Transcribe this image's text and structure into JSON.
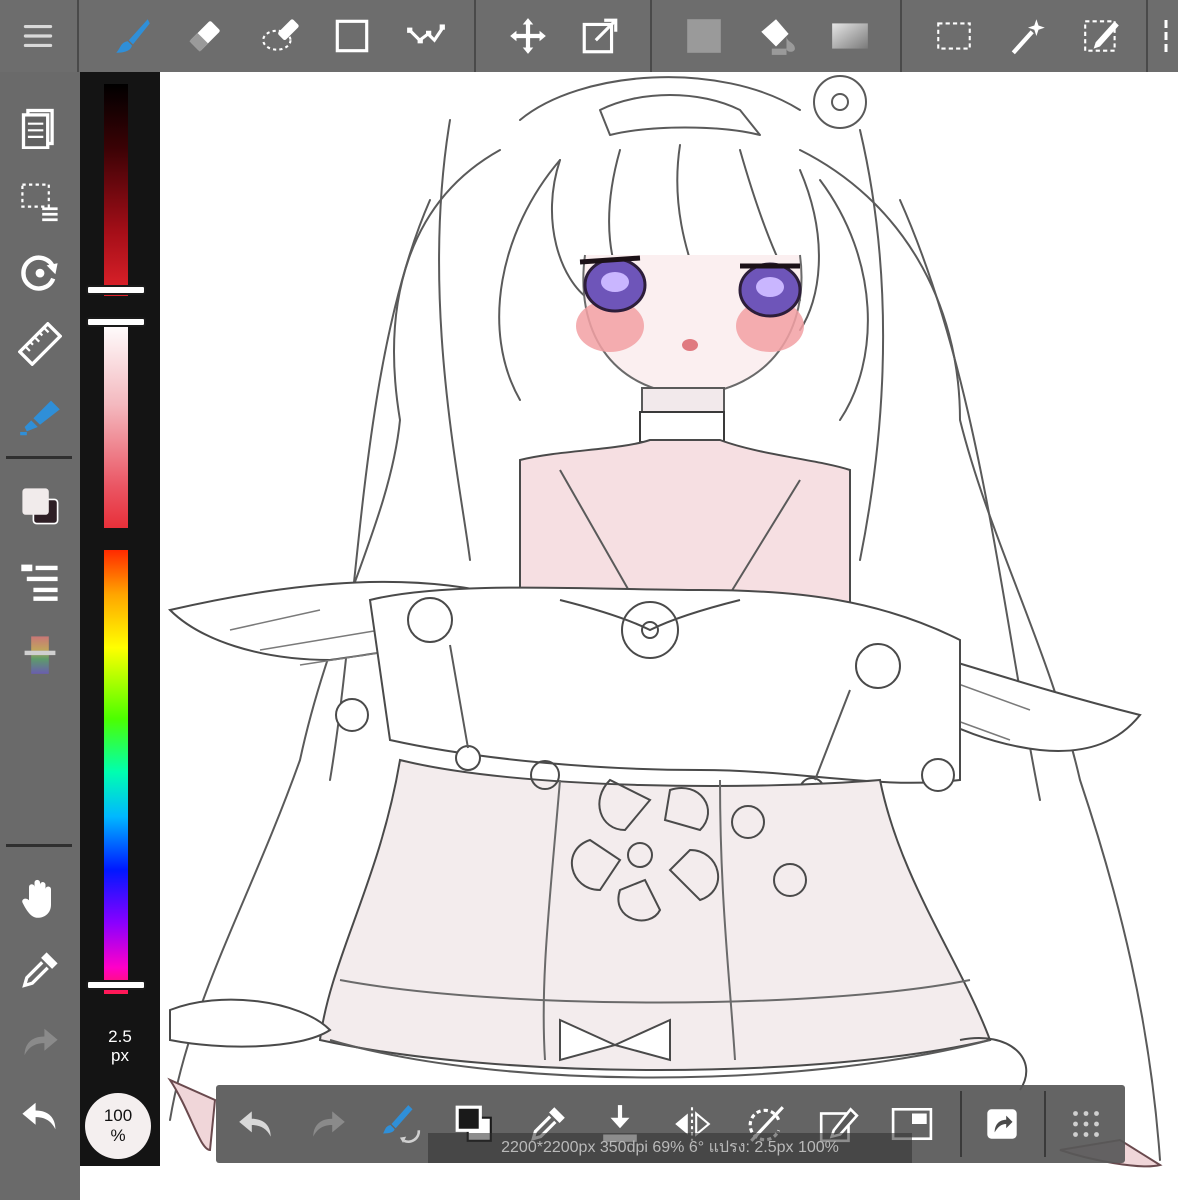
{
  "top_toolbar": {
    "tools": [
      {
        "name": "brush",
        "icon": "brush-icon",
        "active": true
      },
      {
        "name": "eraser",
        "icon": "eraser-icon"
      },
      {
        "name": "lasso-eraser",
        "icon": "lasso-eraser-icon"
      },
      {
        "name": "shape",
        "icon": "shape-square-icon"
      },
      {
        "name": "stroke-correction",
        "icon": "stroke-correction-icon"
      },
      {
        "name": "move",
        "icon": "move-icon"
      },
      {
        "name": "transform",
        "icon": "transform-icon"
      },
      {
        "name": "fill-rect",
        "icon": "fill-rect-icon"
      },
      {
        "name": "bucket",
        "icon": "bucket-icon"
      },
      {
        "name": "gradient",
        "icon": "gradient-icon"
      },
      {
        "name": "select-rect",
        "icon": "select-rect-icon"
      },
      {
        "name": "magic-wand",
        "icon": "magic-wand-icon"
      },
      {
        "name": "select-pen",
        "icon": "select-pen-icon"
      }
    ]
  },
  "left_sidebar": {
    "items": [
      {
        "name": "layers",
        "icon": "layers-icon"
      },
      {
        "name": "selection-menu",
        "icon": "selection-menu-icon"
      },
      {
        "name": "rotate-canvas",
        "icon": "rotate-canvas-icon"
      },
      {
        "name": "ruler",
        "icon": "ruler-icon"
      },
      {
        "name": "brush-settings",
        "icon": "brush-settings-icon",
        "active": true
      },
      {
        "name": "color-swatch",
        "icon": "color-swatch-icon"
      },
      {
        "name": "layer-list",
        "icon": "layer-list-icon"
      },
      {
        "name": "palette",
        "icon": "palette-icon"
      },
      {
        "name": "hand",
        "icon": "hand-icon"
      },
      {
        "name": "eyedropper",
        "icon": "eyedropper-icon"
      },
      {
        "name": "redo",
        "icon": "redo-icon"
      },
      {
        "name": "undo",
        "icon": "undo-icon"
      }
    ],
    "primary_color": "#f1ebeb",
    "secondary_color": "#2e1f25"
  },
  "color_panel": {
    "brightness_level": 0.97,
    "saturation_level": 0.0,
    "hue_level": 0.98,
    "brush_size": "2.5",
    "brush_size_unit": "px",
    "opacity": "100",
    "opacity_unit": "%"
  },
  "bottom_toolbar": {
    "items": [
      {
        "name": "undo",
        "icon": "undo-icon"
      },
      {
        "name": "redo",
        "icon": "redo-icon"
      },
      {
        "name": "brush-swap",
        "icon": "brush-swap-icon"
      },
      {
        "name": "color-swap",
        "icon": "color-swap-icon"
      },
      {
        "name": "eyedropper",
        "icon": "eyedropper-icon"
      },
      {
        "name": "save",
        "icon": "save-icon"
      },
      {
        "name": "flip",
        "icon": "flip-icon"
      },
      {
        "name": "reset-rotation",
        "icon": "reset-rotation-icon"
      },
      {
        "name": "edit-layer",
        "icon": "edit-layer-icon"
      },
      {
        "name": "fullscreen",
        "icon": "fullscreen-icon"
      },
      {
        "name": "share",
        "icon": "share-icon"
      },
      {
        "name": "more",
        "icon": "more-icon"
      }
    ],
    "status_text": "2200*2200px 350dpi 69% 6° แปรง: 2.5px 100%"
  },
  "colors": {
    "toolbar_bg": "#626262",
    "accent_blue": "#2f8fd8",
    "icon_white": "#ffffff",
    "canvas_bg": "#ffffff"
  }
}
